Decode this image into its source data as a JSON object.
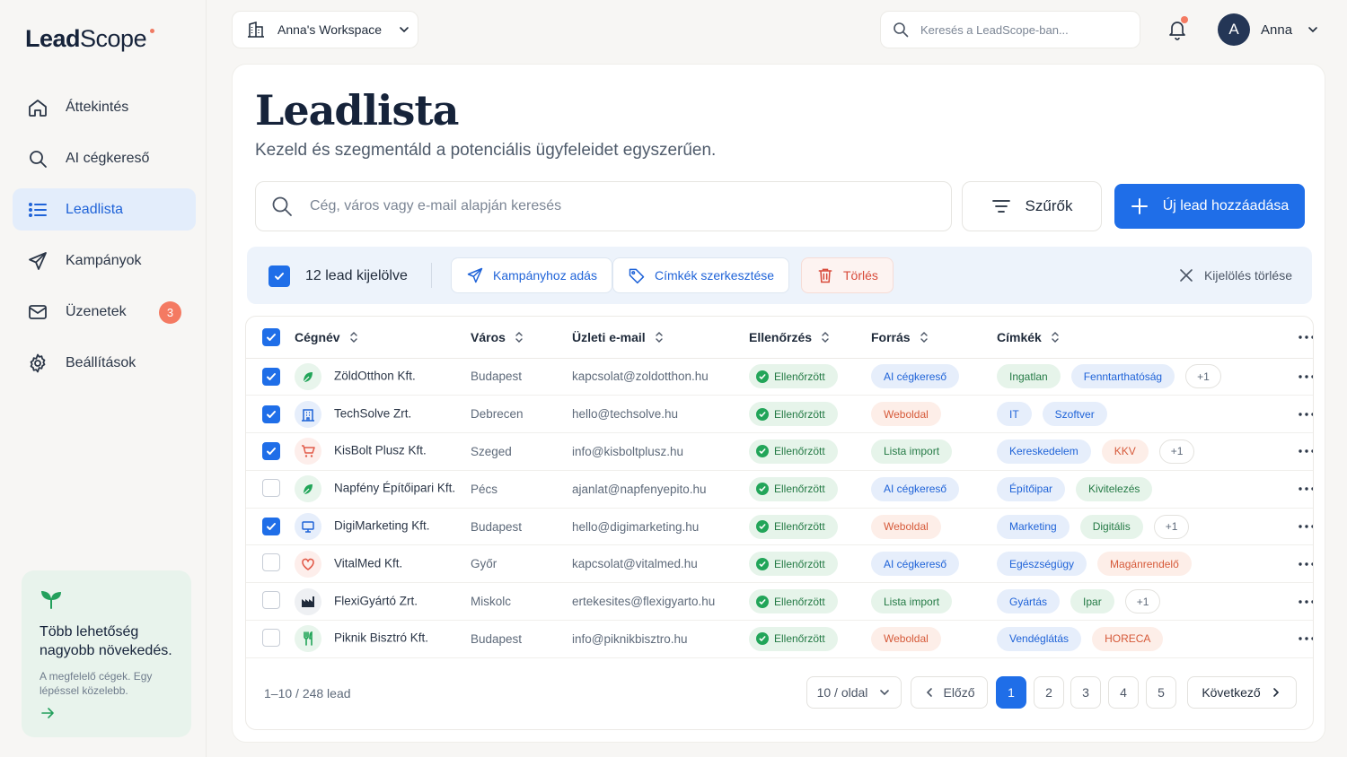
{
  "colors": {
    "accent": "#1f6ee8",
    "danger": "#d84a3a",
    "verified": "#22a559"
  },
  "sidebar": {
    "logo_bold": "Lead",
    "logo_light": "Scope",
    "items": [
      {
        "label": "Áttekintés",
        "icon": "home-icon"
      },
      {
        "label": "AI cégkereső",
        "icon": "search-icon"
      },
      {
        "label": "Leadlista",
        "icon": "list-icon"
      },
      {
        "label": "Kampányok",
        "icon": "send-icon"
      },
      {
        "label": "Üzenetek",
        "icon": "mail-icon",
        "badge": "3"
      },
      {
        "label": "Beállítások",
        "icon": "gear-icon"
      }
    ],
    "promo": {
      "title": "Több lehetőség nagyobb növekedés.",
      "text": "A megfelelő cégek. Egy lépéssel közelebb."
    }
  },
  "topbar": {
    "workspace": "Anna's Workspace",
    "search_placeholder": "Keresés a LeadScope-ban...",
    "user_initial": "A",
    "user_name": "Anna"
  },
  "page": {
    "title": "Leadlista",
    "subtitle": "Kezeld és szegmentáld a potenciális ügyfeleidet egyszerűen.",
    "search_placeholder": "Cég, város vagy e-mail alapján keresés",
    "filters_label": "Szűrők",
    "add_label": "Új lead hozzáadása"
  },
  "selection": {
    "count_label": "12 lead kijelölve",
    "campaign_label": "Kampányhoz adás",
    "tags_label": "Címkék szerkesztése",
    "delete_label": "Törlés",
    "clear_label": "Kijelölés törlése"
  },
  "table": {
    "columns": [
      "Cégnév",
      "Város",
      "Üzleti e-mail",
      "Ellenőrzés",
      "Forrás",
      "Címkék"
    ],
    "rows": [
      {
        "checked": true,
        "icon": "leaf-icon",
        "iconColor": "#22a559",
        "iconBg": "#e8f5ec",
        "name": "ZöldOtthon Kft.",
        "city": "Budapest",
        "email": "kapcsolat@zoldotthon.hu",
        "status": "Ellenőrzött",
        "source": "AI cégkereső",
        "sourceType": "ai",
        "tags": [
          {
            "t": "Ingatlan",
            "c": "green"
          },
          {
            "t": "Fenntarthatóság",
            "c": "blue"
          }
        ],
        "more": "+1"
      },
      {
        "checked": true,
        "icon": "building-icon",
        "iconColor": "#1f63d8",
        "iconBg": "#e6eefb",
        "name": "TechSolve Zrt.",
        "city": "Debrecen",
        "email": "hello@techsolve.hu",
        "status": "Ellenőrzött",
        "source": "Weboldal",
        "sourceType": "web",
        "tags": [
          {
            "t": "IT",
            "c": "blue"
          },
          {
            "t": "Szoftver",
            "c": "blue"
          }
        ],
        "more": ""
      },
      {
        "checked": true,
        "icon": "cart-icon",
        "iconColor": "#e25b4a",
        "iconBg": "#fdeeeb",
        "name": "KisBolt Plusz Kft.",
        "city": "Szeged",
        "email": "info@kisboltplusz.hu",
        "status": "Ellenőrzött",
        "source": "Lista import",
        "sourceType": "list",
        "tags": [
          {
            "t": "Kereskedelem",
            "c": "blue"
          },
          {
            "t": "KKV",
            "c": "orange"
          }
        ],
        "more": "+1"
      },
      {
        "checked": false,
        "icon": "leaf-icon",
        "iconColor": "#22a559",
        "iconBg": "#e8f5ec",
        "name": "Napfény Építőipari Kft.",
        "city": "Pécs",
        "email": "ajanlat@napfenyepito.hu",
        "status": "Ellenőrzött",
        "source": "AI cégkereső",
        "sourceType": "ai",
        "tags": [
          {
            "t": "Építőipar",
            "c": "blue"
          },
          {
            "t": "Kivitelezés",
            "c": "green"
          }
        ],
        "more": ""
      },
      {
        "checked": true,
        "icon": "monitor-icon",
        "iconColor": "#1f63d8",
        "iconBg": "#e6eefb",
        "name": "DigiMarketing Kft.",
        "city": "Budapest",
        "email": "hello@digimarketing.hu",
        "status": "Ellenőrzött",
        "source": "Weboldal",
        "sourceType": "web",
        "tags": [
          {
            "t": "Marketing",
            "c": "blue"
          },
          {
            "t": "Digitális",
            "c": "green"
          }
        ],
        "more": "+1"
      },
      {
        "checked": false,
        "icon": "heart-icon",
        "iconColor": "#e25b4a",
        "iconBg": "#fdeeeb",
        "name": "VitalMed Kft.",
        "city": "Győr",
        "email": "kapcsolat@vitalmed.hu",
        "status": "Ellenőrzött",
        "source": "AI cégkereső",
        "sourceType": "ai",
        "tags": [
          {
            "t": "Egészségügy",
            "c": "blue"
          },
          {
            "t": "Magánrendelő",
            "c": "orange"
          }
        ],
        "more": ""
      },
      {
        "checked": false,
        "icon": "factory-icon",
        "iconColor": "#1f2a3a",
        "iconBg": "#eef0f3",
        "name": "FlexiGyártó Zrt.",
        "city": "Miskolc",
        "email": "ertekesites@flexigyarto.hu",
        "status": "Ellenőrzött",
        "source": "Lista import",
        "sourceType": "list",
        "tags": [
          {
            "t": "Gyártás",
            "c": "blue"
          },
          {
            "t": "Ipar",
            "c": "green"
          }
        ],
        "more": "+1"
      },
      {
        "checked": false,
        "icon": "cutlery-icon",
        "iconColor": "#22a559",
        "iconBg": "#e8f5ec",
        "name": "Piknik Bisztró Kft.",
        "city": "Budapest",
        "email": "info@piknikbisztro.hu",
        "status": "Ellenőrzött",
        "source": "Weboldal",
        "sourceType": "web",
        "tags": [
          {
            "t": "Vendéglátás",
            "c": "blue"
          },
          {
            "t": "HORECA",
            "c": "orange"
          }
        ],
        "more": ""
      }
    ]
  },
  "pagination": {
    "info": "1–10 / 248 lead",
    "per_page": "10 / oldal",
    "prev": "Előző",
    "pages": [
      "1",
      "2",
      "3",
      "4",
      "5"
    ],
    "current": "1",
    "next": "Következő"
  }
}
